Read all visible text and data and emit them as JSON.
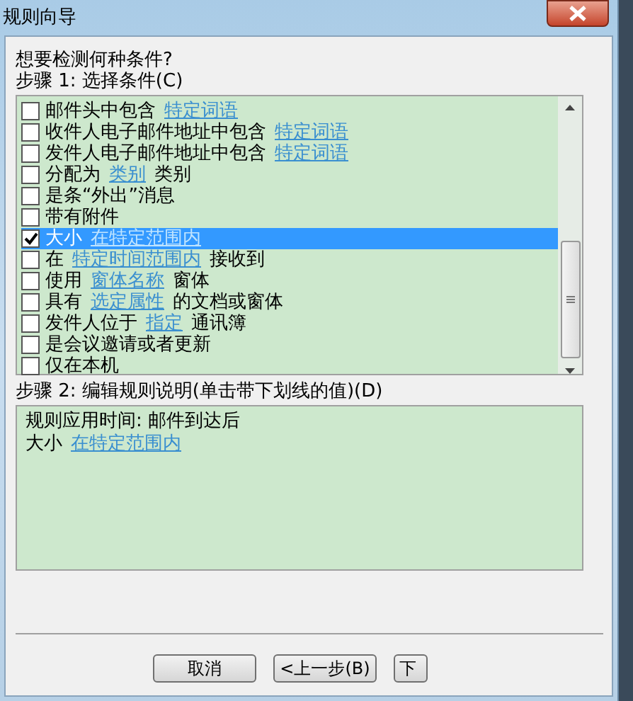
{
  "window": {
    "title": "规则向导"
  },
  "question": "想要检测何种条件?",
  "step1_label": "步骤 1: 选择条件(C)",
  "conditions": [
    {
      "checked": false,
      "selected": false,
      "parts": [
        {
          "kind": "text",
          "text": "邮件头中包含"
        },
        {
          "kind": "link",
          "text": "特定词语"
        }
      ]
    },
    {
      "checked": false,
      "selected": false,
      "parts": [
        {
          "kind": "text",
          "text": "收件人电子邮件地址中包含"
        },
        {
          "kind": "link",
          "text": "特定词语"
        }
      ]
    },
    {
      "checked": false,
      "selected": false,
      "parts": [
        {
          "kind": "text",
          "text": "发件人电子邮件地址中包含"
        },
        {
          "kind": "link",
          "text": "特定词语"
        }
      ]
    },
    {
      "checked": false,
      "selected": false,
      "parts": [
        {
          "kind": "text",
          "text": "分配为"
        },
        {
          "kind": "link",
          "text": "类别"
        },
        {
          "kind": "text",
          "text": "类别"
        }
      ]
    },
    {
      "checked": false,
      "selected": false,
      "parts": [
        {
          "kind": "text",
          "text": "是条“外出”消息"
        }
      ]
    },
    {
      "checked": false,
      "selected": false,
      "parts": [
        {
          "kind": "text",
          "text": "带有附件"
        }
      ]
    },
    {
      "checked": true,
      "selected": true,
      "parts": [
        {
          "kind": "text",
          "text": "大小"
        },
        {
          "kind": "link",
          "text": "在特定范围内"
        }
      ]
    },
    {
      "checked": false,
      "selected": false,
      "parts": [
        {
          "kind": "text",
          "text": "在"
        },
        {
          "kind": "link",
          "text": "特定时间范围内"
        },
        {
          "kind": "text",
          "text": "接收到"
        }
      ]
    },
    {
      "checked": false,
      "selected": false,
      "parts": [
        {
          "kind": "text",
          "text": "使用"
        },
        {
          "kind": "link",
          "text": "窗体名称"
        },
        {
          "kind": "text",
          "text": "窗体"
        }
      ]
    },
    {
      "checked": false,
      "selected": false,
      "parts": [
        {
          "kind": "text",
          "text": "具有"
        },
        {
          "kind": "link",
          "text": "选定属性"
        },
        {
          "kind": "text",
          "text": "的文档或窗体"
        }
      ]
    },
    {
      "checked": false,
      "selected": false,
      "parts": [
        {
          "kind": "text",
          "text": "发件人位于"
        },
        {
          "kind": "link",
          "text": "指定"
        },
        {
          "kind": "text",
          "text": "通讯簿"
        }
      ]
    },
    {
      "checked": false,
      "selected": false,
      "parts": [
        {
          "kind": "text",
          "text": "是会议邀请或者更新"
        }
      ]
    },
    {
      "checked": false,
      "selected": false,
      "parts": [
        {
          "kind": "text",
          "text": "仅在本机"
        }
      ]
    }
  ],
  "step2_label": "步骤 2: 编辑规则说明(单击带下划线的值)(D)",
  "description": [
    [
      {
        "kind": "text",
        "text": "规则应用时间: 邮件到达后"
      }
    ],
    [
      {
        "kind": "text",
        "text": "大小"
      },
      {
        "kind": "link",
        "text": "在特定范围内"
      }
    ]
  ],
  "buttons": [
    {
      "label": "取消"
    },
    {
      "label": "<上一步(B)"
    },
    {
      "label": "下"
    }
  ]
}
